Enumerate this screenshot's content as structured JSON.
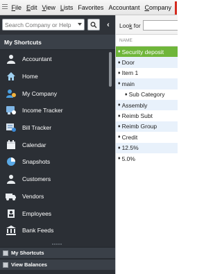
{
  "menubar": {
    "items": [
      {
        "label": "File",
        "ul": "F",
        "rest": "ile"
      },
      {
        "label": "Edit",
        "ul": "E",
        "rest": "dit"
      },
      {
        "label": "View",
        "ul": "V",
        "rest": "iew"
      },
      {
        "label": "Lists",
        "ul": "L",
        "rest": "ists"
      },
      {
        "label": "Favorites",
        "ul": "",
        "rest": "Favorites"
      },
      {
        "label": "Accountant",
        "ul": "",
        "rest": "Accountant"
      },
      {
        "label": "Company",
        "ul": "C",
        "rest": "ompany"
      }
    ]
  },
  "sidebar": {
    "search_placeholder": "Search Company or Help",
    "collapse_glyph": "‹",
    "header": "My Shortcuts",
    "items": [
      {
        "label": "Accountant",
        "icon": "accountant-icon"
      },
      {
        "label": "Home",
        "icon": "home-icon"
      },
      {
        "label": "My Company",
        "icon": "my-company-icon"
      },
      {
        "label": "Income Tracker",
        "icon": "income-tracker-icon"
      },
      {
        "label": "Bill Tracker",
        "icon": "bill-tracker-icon"
      },
      {
        "label": "Calendar",
        "icon": "calendar-icon"
      },
      {
        "label": "Snapshots",
        "icon": "snapshots-icon"
      },
      {
        "label": "Customers",
        "icon": "customers-icon"
      },
      {
        "label": "Vendors",
        "icon": "vendors-icon"
      },
      {
        "label": "Employees",
        "icon": "employees-icon"
      },
      {
        "label": "Bank Feeds",
        "icon": "bank-feeds-icon"
      }
    ],
    "bottom": [
      {
        "label": "My Shortcuts"
      },
      {
        "label": "View Balances"
      }
    ]
  },
  "list_panel": {
    "look_for_label": "Look for",
    "look_for_underline": "k",
    "column_header": "NAME",
    "rows": [
      {
        "label": "Security deposit",
        "selected": true,
        "sub": false
      },
      {
        "label": "Door",
        "selected": false,
        "sub": false
      },
      {
        "label": "Item 1",
        "selected": false,
        "sub": false
      },
      {
        "label": "main",
        "selected": false,
        "sub": false
      },
      {
        "label": "Sub Category",
        "selected": false,
        "sub": true
      },
      {
        "label": "Assembly",
        "selected": false,
        "sub": false
      },
      {
        "label": "Reimb Subt",
        "selected": false,
        "sub": false
      },
      {
        "label": "Reimb Group",
        "selected": false,
        "sub": false
      },
      {
        "label": "Credit",
        "selected": false,
        "sub": false
      },
      {
        "label": "12.5%",
        "selected": false,
        "sub": false
      },
      {
        "label": "5.0%",
        "selected": false,
        "sub": false
      }
    ]
  },
  "colors": {
    "sidebar_bg": "#2b2f35",
    "selected_row": "#6fb63a",
    "alt_row": "#e8f1fb"
  }
}
